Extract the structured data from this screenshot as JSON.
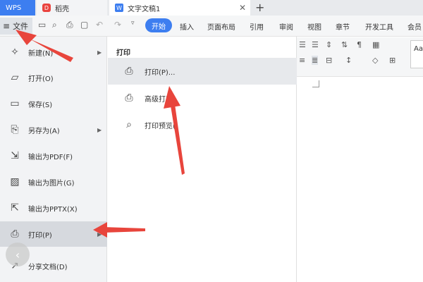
{
  "tabs": {
    "wps": "WPS",
    "daoke": "稻壳",
    "doc": "文字文稿1",
    "close_glyph": "✕",
    "add_glyph": "+"
  },
  "toolbar": {
    "file_menu": "文件",
    "ribbon_tabs": [
      "开始",
      "插入",
      "页面布局",
      "引用",
      "审阅",
      "视图",
      "章节",
      "开发工具",
      "会员"
    ]
  },
  "file_menu": {
    "items": [
      {
        "label": "新建(N)",
        "icon": "new-doc-icon",
        "has_submenu": true
      },
      {
        "label": "打开(O)",
        "icon": "folder-open-icon",
        "has_submenu": false
      },
      {
        "label": "保存(S)",
        "icon": "save-icon",
        "has_submenu": false
      },
      {
        "label": "另存为(A)",
        "icon": "save-as-icon",
        "has_submenu": true
      },
      {
        "label": "输出为PDF(F)",
        "icon": "export-pdf-icon",
        "has_submenu": false
      },
      {
        "label": "输出为图片(G)",
        "icon": "export-image-icon",
        "has_submenu": false
      },
      {
        "label": "输出为PPTX(X)",
        "icon": "export-pptx-icon",
        "has_submenu": false
      },
      {
        "label": "打印(P)",
        "icon": "printer-icon",
        "has_submenu": true,
        "active": true
      },
      {
        "label": "分享文档(D)",
        "icon": "share-icon",
        "has_submenu": false
      }
    ]
  },
  "print_submenu": {
    "title": "打印",
    "items": [
      {
        "label": "打印(P)...",
        "icon": "printer-icon",
        "hover": true
      },
      {
        "label": "高级打印",
        "icon": "advanced-print-icon"
      },
      {
        "label": "打印预览(",
        "icon": "print-preview-icon"
      }
    ]
  },
  "style_sample": "Aa",
  "annotation_color": "#e8453c",
  "accent_color": "#3d7ef0"
}
